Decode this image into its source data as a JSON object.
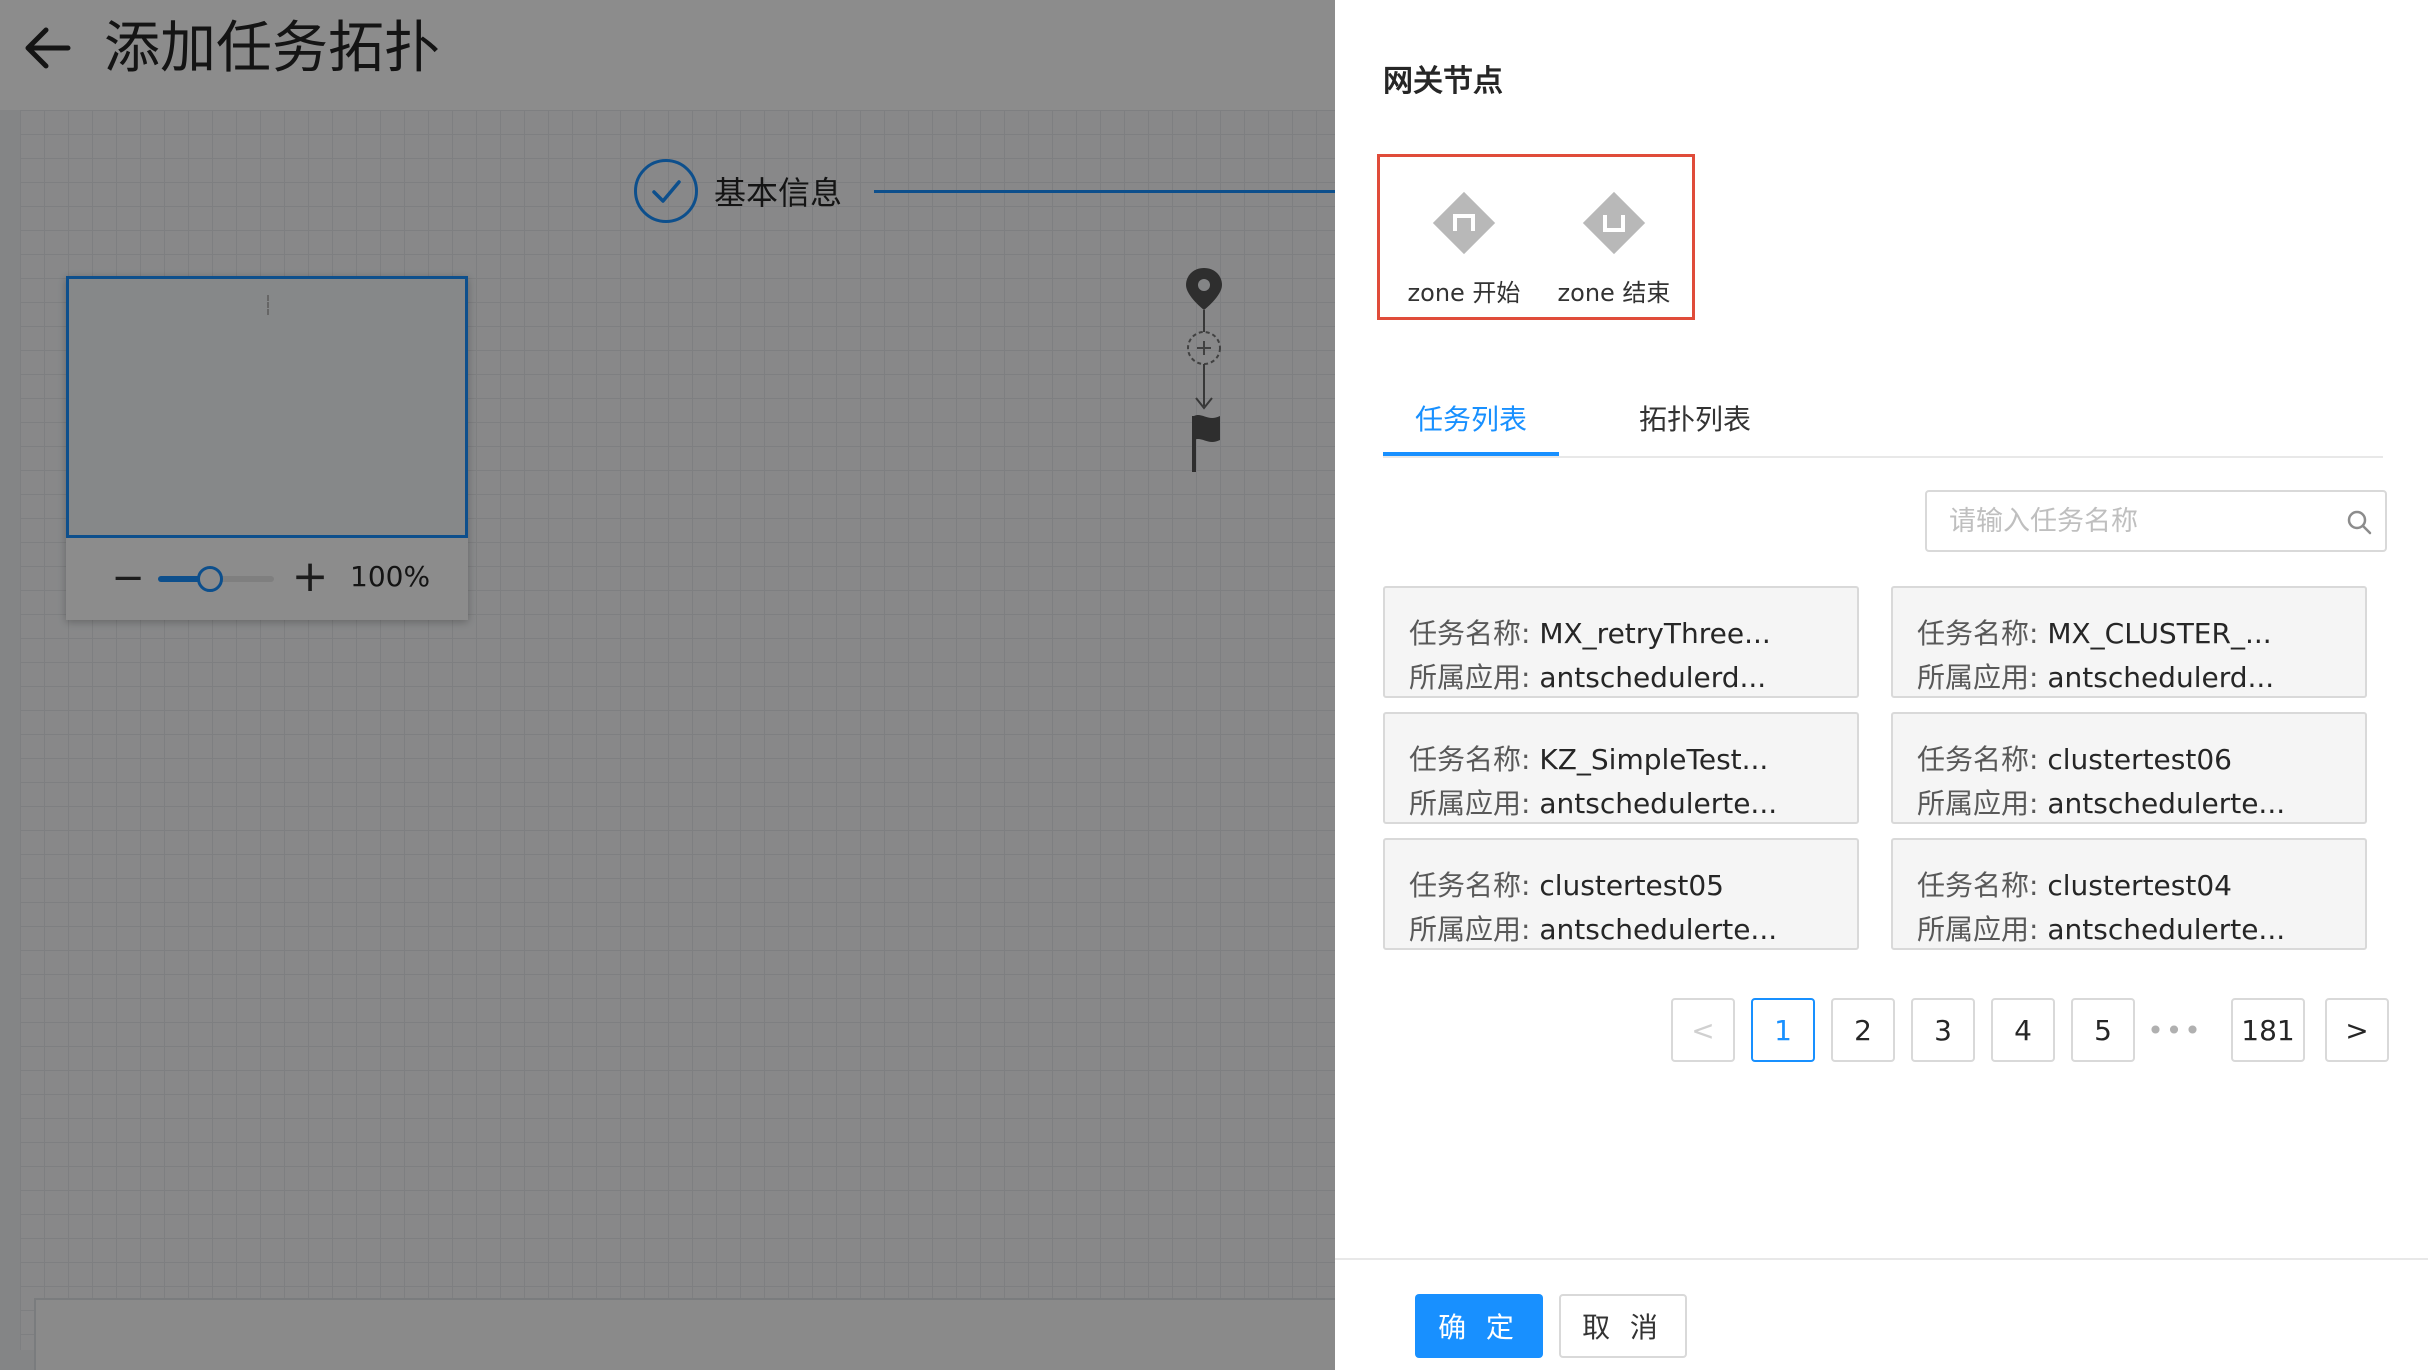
{
  "header": {
    "title": "添加任务拓扑"
  },
  "steps": {
    "current_label": "基本信息"
  },
  "minimap": {
    "zoom_label": "100%",
    "zoom_out": "−",
    "zoom_in": "+",
    "zoom_fraction": 0.45
  },
  "drawer": {
    "title": "网关节点",
    "gateway_nodes": [
      {
        "label": "zone 开始",
        "icon": "zone-start-icon"
      },
      {
        "label": "zone 结束",
        "icon": "zone-end-icon"
      }
    ],
    "tabs": [
      {
        "label": "任务列表",
        "active": true
      },
      {
        "label": "拓扑列表",
        "active": false
      }
    ],
    "search": {
      "placeholder": "请输入任务名称",
      "value": ""
    },
    "task_key_name": "任务名称:",
    "task_key_app": "所属应用:",
    "tasks": [
      {
        "name": "MX_retryThree...",
        "app": "antschedulerd..."
      },
      {
        "name": "MX_CLUSTER_...",
        "app": "antschedulerd..."
      },
      {
        "name": "KZ_SimpleTest...",
        "app": "antschedulerte..."
      },
      {
        "name": "clustertest06",
        "app": "antschedulerte..."
      },
      {
        "name": "clustertest05",
        "app": "antschedulerte..."
      },
      {
        "name": "clustertest04",
        "app": "antschedulerte..."
      }
    ],
    "pagination": {
      "prev": "<",
      "pages": [
        "1",
        "2",
        "3",
        "4",
        "5"
      ],
      "ellipsis": "•••",
      "last": "181",
      "next": ">",
      "current": "1"
    },
    "footer": {
      "ok_label": "确 定",
      "cancel_label": "取 消"
    }
  },
  "colors": {
    "accent": "#1890ff",
    "highlight_border": "#e04c3a"
  }
}
